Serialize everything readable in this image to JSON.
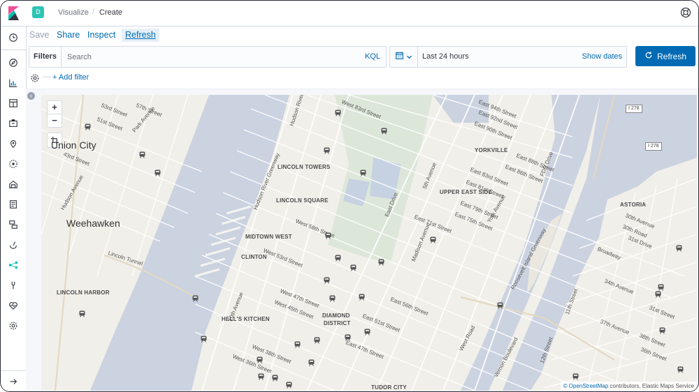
{
  "header": {
    "space_initial": "D",
    "breadcrumbs": [
      "Visualize",
      "Create"
    ],
    "breadcrumb_separator": "/"
  },
  "top_menu": {
    "save": "Save",
    "share": "Share",
    "inspect": "Inspect",
    "refresh": "Refresh"
  },
  "query_bar": {
    "filters_label": "Filters",
    "search_placeholder": "Search",
    "language": "KQL"
  },
  "date_picker": {
    "range": "Last 24 hours",
    "show_dates": "Show dates"
  },
  "refresh_button": {
    "label": "Refresh"
  },
  "filter_bar": {
    "add_filter": "+ Add filter"
  },
  "map": {
    "zoom_in": "+",
    "zoom_out": "−",
    "cities": [
      "Union City",
      "Weehawken"
    ],
    "neighborhoods": [
      "LINCOLN TOWERS",
      "LINCOLN SQUARE",
      "MIDTOWN WEST",
      "CLINTON",
      "HELL'S KITCHEN",
      "DIAMOND",
      "DISTRICT",
      "LINCOLN HARBOR",
      "YORKVILLE",
      "UPPER EAST SIDE",
      "ASTORIA",
      "TUDOR CITY"
    ],
    "streets": [
      "53rd Street",
      "51st Street",
      "57th Street",
      "Park Avenue",
      "43rd Street",
      "Hudson Avenue",
      "Hudson River",
      "West 83rd Street",
      "Hudson River Greenway",
      "West 58th Street",
      "West 53rd Street",
      "West 47th Street",
      "West 45th Street",
      "West 38th Street",
      "West 36th Street",
      "East 94th Street",
      "East 92nd Street",
      "East 90th Street",
      "East 88th Street",
      "East 86th Street",
      "East 83rd Street",
      "East 81st Street",
      "East 79th Street",
      "East 75th Street",
      "East 71st Street",
      "East 56th Street",
      "East 51st Street",
      "East 47th Street",
      "5th Avenue",
      "East Drive",
      "Madison Avenue",
      "York Avenue",
      "FDR Drive",
      "Roosevelt Island Greenway",
      "30th Avenue",
      "30th Road",
      "31st Drive",
      "Broadway",
      "34th Avenue",
      "11th Street",
      "37th Avenue",
      "12th Street",
      "Vernon Boulevard",
      "West Road",
      "Lincoln Tunnel",
      "10th Avenue",
      "38th Street",
      "31st Street",
      "36th Street"
    ],
    "highway_badges": [
      "I 278",
      "I 278"
    ],
    "attribution_osm": "© OpenStreetMap",
    "attribution_rest": " contributors, Elastic Maps Service"
  },
  "colors": {
    "accent": "#006bb4",
    "space_badge": "#2ec4b6",
    "water": "#cbd2e0",
    "park": "#dde7d9",
    "land": "#f1efe9"
  }
}
